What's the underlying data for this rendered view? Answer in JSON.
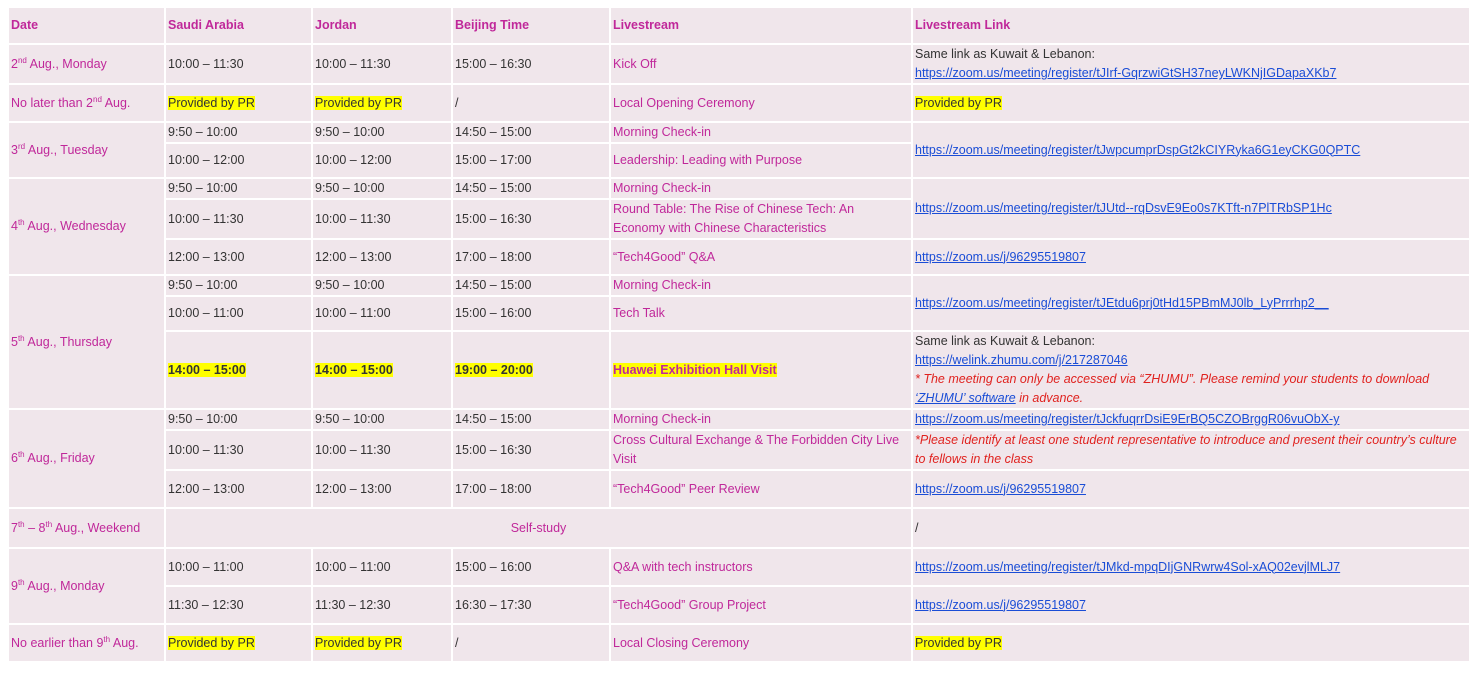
{
  "headers": [
    "Date",
    "Saudi Arabia",
    "Jordan",
    "Beijing Time",
    "Livestream",
    "Livestream Link"
  ],
  "texts": {
    "same_link": "Same link as Kuwait & Lebanon:",
    "provided": "Provided by PR",
    "slash": "/",
    "self_study": "Self-study",
    "zhumu_note_a": "* The meeting can only be accessed via “ZHUMU”. Please remind your students to download ",
    "zhumu_note_link": "‘ZHUMU’ software",
    "zhumu_note_b": " in advance.",
    "rep_note": "*Please identify at least one student representative to introduce and present their country’s culture to fellows in the class"
  },
  "dates": {
    "d1n": "2",
    "d1s": "nd",
    "d1t": " Aug., Monday",
    "d2a": "No later than 2",
    "d2s": "nd",
    "d2t": " Aug.",
    "d3n": "3",
    "d3s": "rd",
    "d3t": " Aug., Tuesday",
    "d4n": "4",
    "d4s": "th",
    "d4t": " Aug., Wednesday",
    "d5n": "5",
    "d5s": "th",
    "d5t": " Aug., Thursday",
    "d6n": "6",
    "d6s": "th",
    "d6t": " Aug., Friday",
    "d7n": "7",
    "d7s": "th",
    "d7m": " – 8",
    "d7s2": "th",
    "d7t": " Aug., Weekend",
    "d8n": "9",
    "d8s": "th",
    "d8t": " Aug., Monday",
    "d9a": "No earlier than 9",
    "d9s": "th",
    "d9t": " Aug."
  },
  "times": {
    "t0930": "9:50 – 10:00",
    "b1450": "14:50 – 15:00",
    "t1011": "10:00 – 11:30",
    "b1516": "15:00 – 16:30",
    "t1012": "10:00 – 12:00",
    "b1517": "15:00 – 17:00",
    "t1213": "12:00 – 13:00",
    "b1718": "17:00 – 18:00",
    "t1011b": "10:00 – 11:00",
    "b1516b": "15:00 – 16:00",
    "t1415": "14:00 – 15:00",
    "b1920": "19:00 – 20:00",
    "t1112": "11:30 – 12:30",
    "b1617": "16:30 – 17:30"
  },
  "events": {
    "kickoff": "Kick Off",
    "opening": "Local Opening Ceremony",
    "checkin": "Morning Check-in",
    "leadership": "Leadership: Leading with Purpose",
    "roundtable": "Round Table: The Rise of Chinese Tech: An Economy with Chinese Characteristics",
    "qa": "“Tech4Good” Q&A",
    "techtalk": "Tech Talk",
    "huawei": "Huawei Exhibition Hall Visit",
    "cross": "Cross Cultural Exchange & The Forbidden City Live Visit",
    "peer": "“Tech4Good” Peer Review",
    "qatech": "Q&A with tech instructors",
    "group": "“Tech4Good” Group Project",
    "closing": "Local Closing Ceremony"
  },
  "links": {
    "l1": "https://zoom.us/meeting/register/tJIrf-GqrzwiGtSH37neyLWKNjIGDapaXKb7",
    "l2": "https://zoom.us/meeting/register/tJwpcumprDspGt2kCIYRyka6G1eyCKG0QPTC",
    "l3": "https://zoom.us/meeting/register/tJUtd--rqDsvE9Eo0s7KTft-n7PlTRbSP1Hc",
    "l4": "https://zoom.us/j/96295519807",
    "l5": "https://zoom.us/meeting/register/tJEtdu6prj0tHd15PBmMJ0lb_LyPrrrhp2__",
    "l6": "https://welink.zhumu.com/j/217287046",
    "l7": "https://zoom.us/meeting/register/tJckfuqrrDsiE9ErBQ5CZOBrggR06vuObX-y",
    "l8": "https://zoom.us/meeting/register/tJMkd-mpqDIjGNRwrw4Sol-xAQ02evjlMLJ7"
  },
  "colors": {
    "accent": "#c0289a",
    "cell_bg": "#f0e6eb",
    "highlight": "#ffff00",
    "link": "#1a4dd6",
    "note": "#e0221f"
  }
}
